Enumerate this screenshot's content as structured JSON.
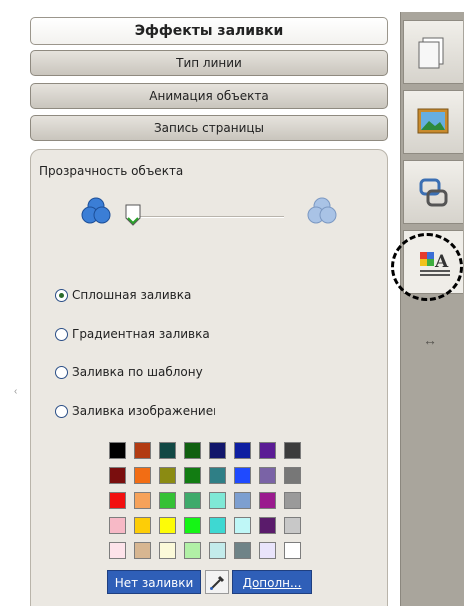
{
  "accordion": {
    "headers": [
      "Эффекты заливки",
      "Тип линии",
      "Анимация объекта",
      "Запись страницы"
    ]
  },
  "fill": {
    "transparency_label": "Прозрачность объекта",
    "transparency_value": 0.0,
    "options": [
      {
        "label": "Сплошная заливка",
        "checked": true
      },
      {
        "label": "Градиентная заливка",
        "checked": false
      },
      {
        "label": "Заливка по шаблону",
        "checked": false
      },
      {
        "label": "Заливка изображением",
        "checked": false
      }
    ],
    "palette": [
      [
        "#000000",
        "#b23b12",
        "#114844",
        "#106010",
        "#11166b",
        "#0d1ea1",
        "#5b1c95",
        "#3c3c3c"
      ],
      [
        "#7a0e0e",
        "#f26d14",
        "#8b8b12",
        "#127c12",
        "#2f7f86",
        "#1f4aff",
        "#7a63a6",
        "#777777"
      ],
      [
        "#f20f0f",
        "#f6a25a",
        "#35c135",
        "#3faa6b",
        "#7fe8d6",
        "#7d9fd0",
        "#9a1a8e",
        "#9a9a9a"
      ],
      [
        "#f7b9c6",
        "#fdcd07",
        "#fdfc07",
        "#15f515",
        "#3ed8d2",
        "#bff7f7",
        "#5a1b6b",
        "#c8c8c8"
      ],
      [
        "#fde3ea",
        "#d7b691",
        "#fbf9d9",
        "#b1f0a6",
        "#c3ebeb",
        "#6f8387",
        "#e9e4fb",
        "#ffffff"
      ]
    ],
    "no_fill_label": "Нет заливки",
    "more_label": "Дополн..."
  },
  "sidebar": {
    "icons": [
      "page-icon",
      "picture-icon",
      "link-icon",
      "properties-icon"
    ],
    "active_index": 3,
    "collapse_symbol": "↔"
  }
}
